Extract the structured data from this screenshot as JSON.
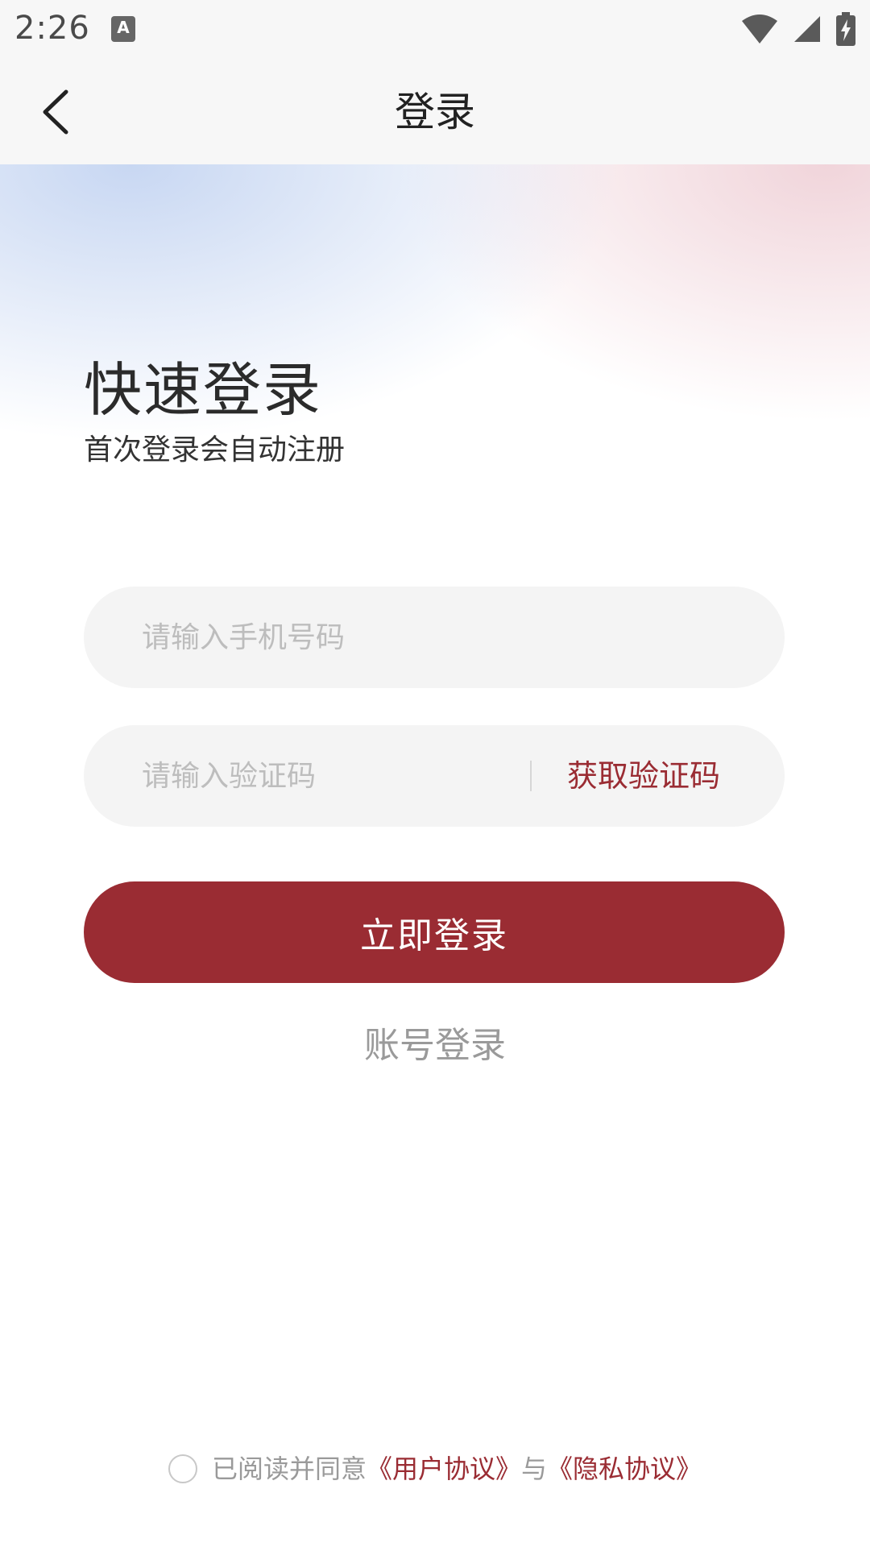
{
  "status_bar": {
    "time": "2:26",
    "notification_letter": "A",
    "icons": [
      "wifi-icon",
      "signal-icon",
      "battery-charging-icon"
    ]
  },
  "nav": {
    "title": "登录",
    "back_icon": "chevron-left-icon"
  },
  "hero": {
    "title": "快速登录",
    "subtitle": "首次登录会自动注册"
  },
  "form": {
    "phone_placeholder": "请输入手机号码",
    "phone_value": "",
    "code_placeholder": "请输入验证码",
    "code_value": "",
    "get_code_label": "获取验证码",
    "submit_label": "立即登录",
    "account_login_label": "账号登录"
  },
  "agreement": {
    "checked": false,
    "prefix": "已阅读并同意",
    "user_agreement": "《用户协议》",
    "connector": "与",
    "privacy_agreement": "《隐私协议》"
  },
  "colors": {
    "accent": "#9a2c33",
    "placeholder": "#bdbdbd",
    "field_bg": "#f4f4f4",
    "bar_bg": "#f7f7f7"
  }
}
